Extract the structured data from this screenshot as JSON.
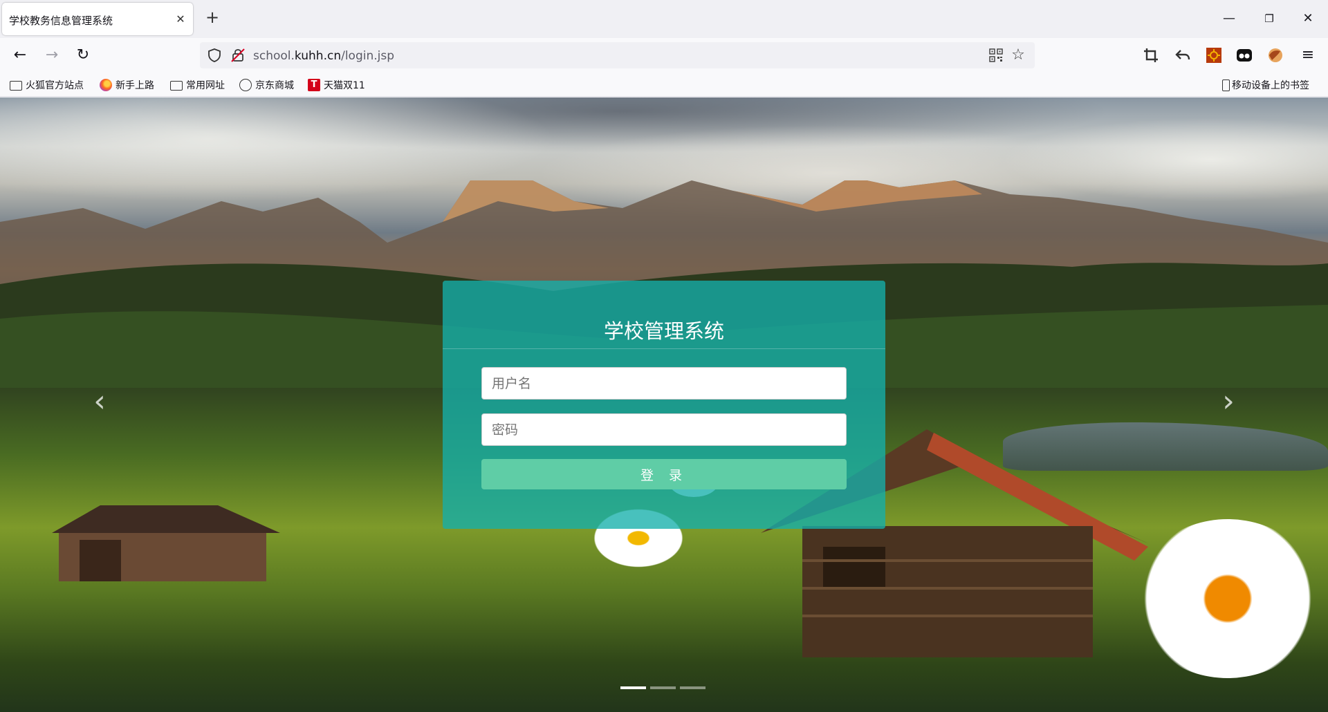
{
  "browser": {
    "tab": {
      "title": "学校教务信息管理系统",
      "close": "✕"
    },
    "new_tab": "+",
    "window": {
      "minimize": "—",
      "restore": "❐",
      "close": "✕"
    },
    "nav": {
      "back": "←",
      "forward": "→",
      "reload": "↻"
    },
    "url": {
      "prefix": "school.",
      "domain": "kuhh.cn",
      "path": "/login.jsp"
    },
    "bookmarks": [
      {
        "label": "火狐官方站点",
        "icon": "folder-icon"
      },
      {
        "label": "新手上路",
        "icon": "firefox-icon"
      },
      {
        "label": "常用网址",
        "icon": "folder-icon"
      },
      {
        "label": "京东商城",
        "icon": "globe-icon"
      },
      {
        "label": "天猫双11",
        "icon": "tmall-icon",
        "icon_text": "T"
      }
    ],
    "mobile_bookmarks": "移动设备上的书签"
  },
  "page": {
    "carousel": {
      "prev": "‹",
      "next": "›",
      "slide_count": 3,
      "active_slide": 1
    },
    "login": {
      "title": "学校管理系统",
      "username_placeholder": "用户名",
      "password_placeholder": "密码",
      "submit_label": "登 录"
    }
  },
  "colors": {
    "panel": "#14afaa",
    "button": "#5fcda6",
    "tab_bg": "#f0f0f4",
    "toolbar_bg": "#f9f9fb"
  }
}
